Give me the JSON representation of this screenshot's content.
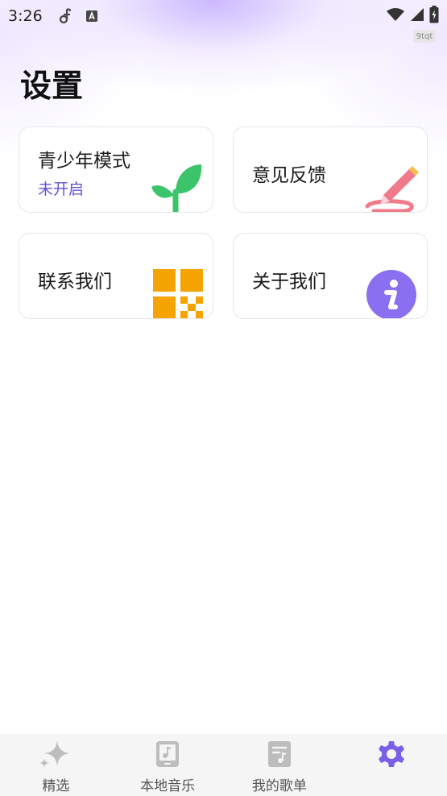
{
  "status_bar": {
    "time": "3:26",
    "icons": [
      "music-note-icon",
      "a-letter-icon"
    ],
    "right_icons": [
      "wifi-icon",
      "signal-icon",
      "battery-icon"
    ]
  },
  "corner_tag": "9tqt",
  "page_title": "设置",
  "cards": [
    {
      "title": "青少年模式",
      "subtitle": "未开启",
      "icon": "sprout-icon"
    },
    {
      "title": "意见反馈",
      "icon": "pencil-icon"
    },
    {
      "title": "联系我们",
      "icon": "qr-code-icon"
    },
    {
      "title": "关于我们",
      "icon": "info-icon"
    }
  ],
  "bottom_nav": [
    {
      "label": "精选",
      "icon": "sparkle-icon",
      "active": false
    },
    {
      "label": "本地音乐",
      "icon": "phone-music-icon",
      "active": false
    },
    {
      "label": "我的歌单",
      "icon": "playlist-icon",
      "active": false
    },
    {
      "label": "",
      "icon": "gear-icon",
      "active": true
    }
  ],
  "colors": {
    "accent": "#7b5fe6",
    "subtitle": "#6a4fd6",
    "sprout": "#3cc46a",
    "pencil": "#f07a8a",
    "qr": "#f5a300",
    "info": "#8a6ff0"
  }
}
